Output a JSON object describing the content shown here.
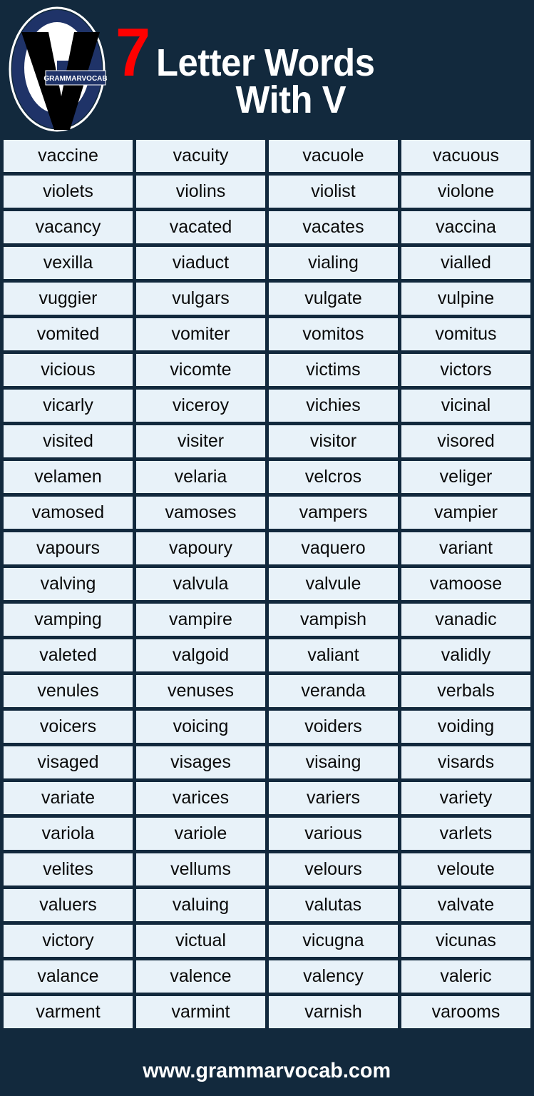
{
  "page": {
    "background_color": "#12293d",
    "cell_background_color": "#e8f2f9",
    "accent_red": "#ff0000",
    "text_color": "#ffffff"
  },
  "header": {
    "number": "7",
    "title_line1": "Letter Words",
    "title_line2": "With V",
    "logo": {
      "banner_text": "GRAMMARVOCAB",
      "ring_color": "#1f3368",
      "letter_color": "#000000"
    }
  },
  "grid": {
    "columns": 4,
    "rows": 25,
    "words": [
      [
        "vaccine",
        "vacuity",
        "vacuole",
        "vacuous"
      ],
      [
        "violets",
        "violins",
        "violist",
        "violone"
      ],
      [
        "vacancy",
        "vacated",
        "vacates",
        "vaccina"
      ],
      [
        "vexilla",
        "viaduct",
        "vialing",
        "vialled"
      ],
      [
        "vuggier",
        "vulgars",
        "vulgate",
        "vulpine"
      ],
      [
        "vomited",
        "vomiter",
        "vomitos",
        "vomitus"
      ],
      [
        "vicious",
        "vicomte",
        "victims",
        "victors"
      ],
      [
        "vicarly",
        "viceroy",
        "vichies",
        "vicinal"
      ],
      [
        "visited",
        "visiter",
        "visitor",
        "visored"
      ],
      [
        "velamen",
        "velaria",
        "velcros",
        "veliger"
      ],
      [
        "vamosed",
        "vamoses",
        "vampers",
        "vampier"
      ],
      [
        "vapours",
        "vapoury",
        "vaquero",
        "variant"
      ],
      [
        "valving",
        "valvula",
        "valvule",
        "vamoose"
      ],
      [
        "vamping",
        "vampire",
        "vampish",
        "vanadic"
      ],
      [
        "valeted",
        "valgoid",
        "valiant",
        "validly"
      ],
      [
        "venules",
        "venuses",
        "veranda",
        "verbals"
      ],
      [
        "voicers",
        "voicing",
        "voiders",
        "voiding"
      ],
      [
        "visaged",
        "visages",
        "visaing",
        "visards"
      ],
      [
        "variate",
        "varices",
        "variers",
        "variety"
      ],
      [
        "variola",
        "variole",
        "various",
        "varlets"
      ],
      [
        "velites",
        "vellums",
        "velours",
        "veloute"
      ],
      [
        "valuers",
        "valuing",
        "valutas",
        "valvate"
      ],
      [
        "victory",
        "victual",
        "vicugna",
        "vicunas"
      ],
      [
        "valance",
        "valence",
        "valency",
        "valeric"
      ],
      [
        "varment",
        "varmint",
        "varnish",
        "varooms"
      ]
    ]
  },
  "footer": {
    "website": "www.grammarvocab.com"
  }
}
